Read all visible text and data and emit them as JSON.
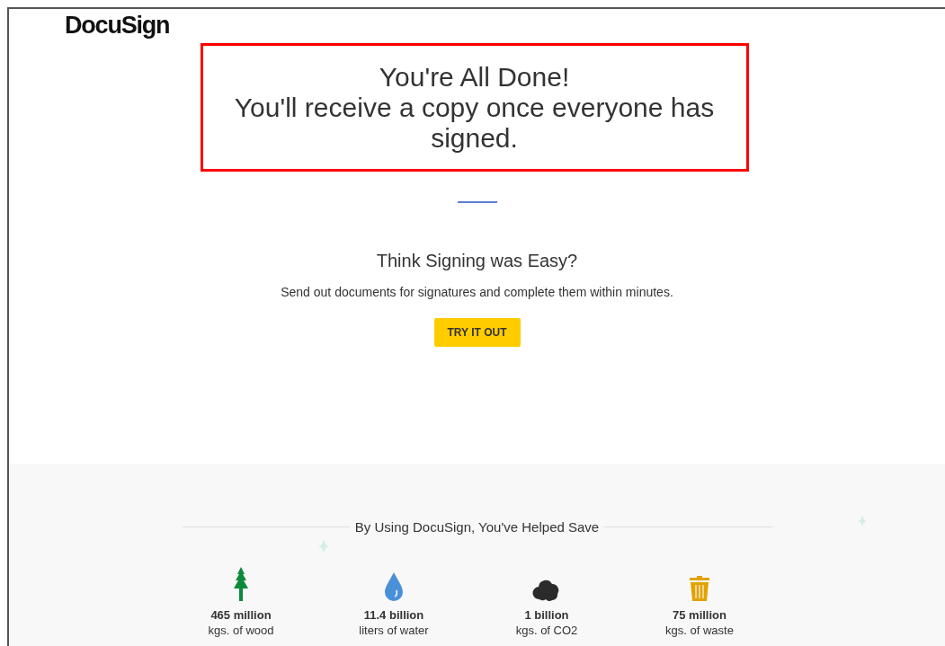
{
  "logo": "DocuSign",
  "done": {
    "title": "You're All Done!",
    "message": "You'll receive a copy once everyone has signed."
  },
  "promo": {
    "title": "Think Signing was Easy?",
    "text": "Send out documents for signatures and complete them within minutes.",
    "button": "TRY IT OUT"
  },
  "savings": {
    "title": "By Using DocuSign, You've Helped Save",
    "stats": [
      {
        "kind": "tree",
        "value": "465 million",
        "label": "kgs. of wood"
      },
      {
        "kind": "drop",
        "value": "11.4 billion",
        "label": "liters of water"
      },
      {
        "kind": "cloud",
        "value": "1 billion",
        "label": "kgs. of CO2"
      },
      {
        "kind": "trash",
        "value": "75 million",
        "label": "kgs. of waste"
      }
    ]
  }
}
